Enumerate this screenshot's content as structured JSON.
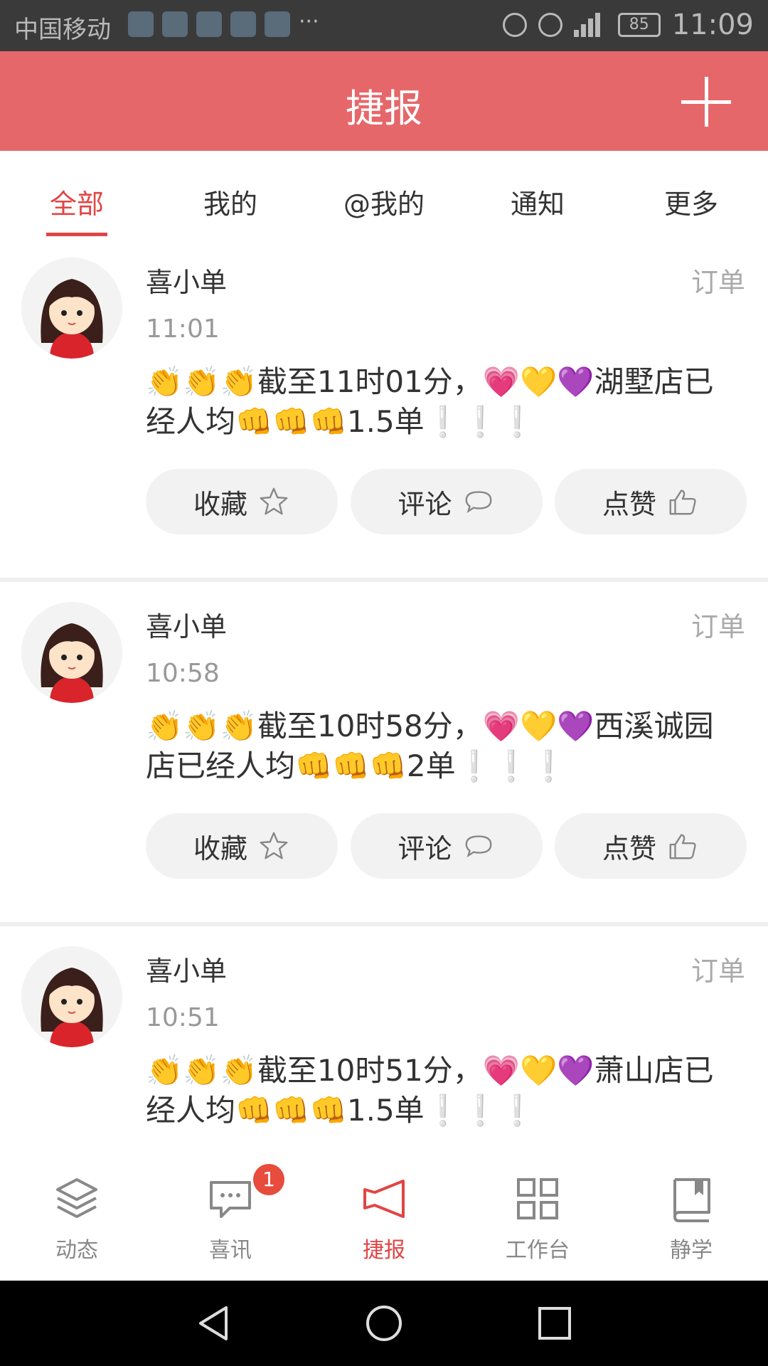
{
  "status_bar": {
    "carrier": "中国移动",
    "battery": "85",
    "time": "11:09"
  },
  "header": {
    "title": "捷报",
    "add_icon": "plus-icon"
  },
  "tabs": [
    {
      "label": "全部",
      "active": true
    },
    {
      "label": "我的",
      "active": false
    },
    {
      "label": "@我的",
      "active": false
    },
    {
      "label": "通知",
      "active": false
    },
    {
      "label": "更多",
      "active": false
    }
  ],
  "posts": [
    {
      "author": "喜小单",
      "tag": "订单",
      "time": "11:01",
      "content": "👏👏👏截至11时01分，💗💛💜湖墅店已经人均👊👊👊1.5单❕❕❕",
      "actions": {
        "favorite": "收藏",
        "comment": "评论",
        "like": "点赞"
      }
    },
    {
      "author": "喜小单",
      "tag": "订单",
      "time": "10:58",
      "content": "👏👏👏截至10时58分，💗💛💜西溪诚园店已经人均👊👊👊2单❕❕❕",
      "actions": {
        "favorite": "收藏",
        "comment": "评论",
        "like": "点赞"
      }
    },
    {
      "author": "喜小单",
      "tag": "订单",
      "time": "10:51",
      "content": "👏👏👏截至10时51分，💗💛💜萧山店已经人均👊👊👊1.5单❕❕❕",
      "actions": {
        "favorite": "收藏",
        "comment": "评论",
        "like": "点赞"
      }
    }
  ],
  "nav": [
    {
      "label": "动态",
      "icon": "layers-icon",
      "active": false
    },
    {
      "label": "喜讯",
      "icon": "chat-bubble-icon",
      "active": false,
      "badge": "1"
    },
    {
      "label": "捷报",
      "icon": "megaphone-icon",
      "active": true
    },
    {
      "label": "工作台",
      "icon": "grid-icon",
      "active": false
    },
    {
      "label": "静学",
      "icon": "book-icon",
      "active": false
    }
  ],
  "colors": {
    "header_bg": "#e5676a",
    "accent": "#e24545",
    "status_bg": "#3a3a3a"
  }
}
